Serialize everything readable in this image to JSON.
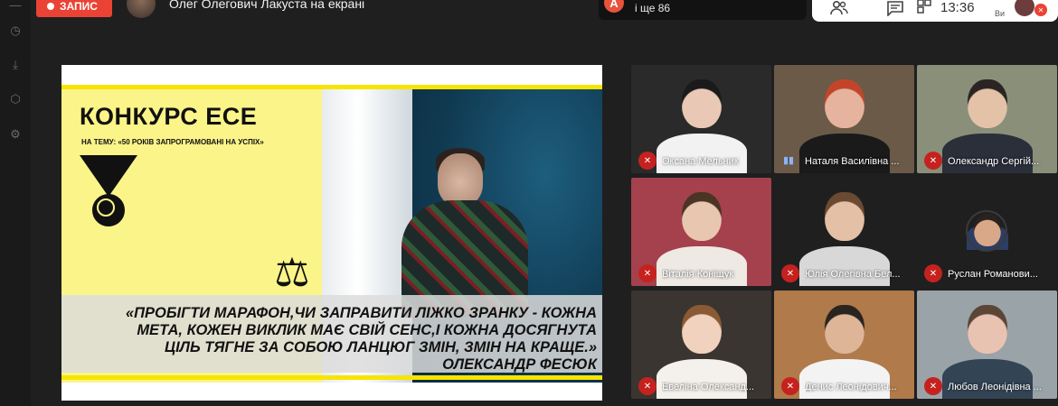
{
  "topbar": {
    "record_label": "ЗАПИС",
    "presenter_text": "Олег Олегович Лакуста на екрані",
    "notification": {
      "avatar_letter": "A",
      "text": "і ще 86"
    },
    "time": "13:36",
    "me_label": "Ви"
  },
  "slide": {
    "title": "КОНКУРС ЕСЕ",
    "subtitle": "НА ТЕМУ: «50 РОКІВ ЗАПРОГРАМОВАНІ НА УСПІХ»",
    "quote_lines": [
      "«ПРОБІГТИ МАРАФОН,ЧИ ЗАПРАВИТИ ЛІЖКО ЗРАНКУ - КОЖНА",
      "МЕТА, КОЖЕН ВИКЛИК МАЄ СВІЙ СЕНС,І КОЖНА ДОСЯГНУТА",
      "ЦІЛЬ ТЯГНЕ ЗА СОБОЮ ЛАНЦЮГ ЗМІН, ЗМІН НА КРАЩЕ.»",
      "ОЛЕКСАНДР ФЕСЮК"
    ]
  },
  "participants": [
    {
      "name": "Оксана Мельник",
      "muted": true,
      "bg": "#2a2a2a",
      "skin": "#e9c9b5",
      "cloth": "#f2f2f2",
      "hair": "#1a1a1a"
    },
    {
      "name": "Наталя Василівна ...",
      "muted": false,
      "bg": "#6b5a48",
      "skin": "#e6b49e",
      "cloth": "#1a1a1a",
      "hair": "#c2452a"
    },
    {
      "name": "Олександр Сергій...",
      "muted": true,
      "bg": "#8a8f7a",
      "skin": "#e4c2a8",
      "cloth": "#2b2f3a",
      "hair": "#2a2522"
    },
    {
      "name": "Віталія Коніщук",
      "muted": true,
      "bg": "#a4414d",
      "skin": "#e9c6b0",
      "cloth": "#efe9e4",
      "hair": "#4a3424"
    },
    {
      "name": "Юлія Олегівна Бел...",
      "muted": true,
      "bg": "#1f1f1f",
      "skin": "#e4c0a6",
      "cloth": "#d8d8d8",
      "hair": "#6a4a32"
    },
    {
      "name": "Руслан Романови...",
      "muted": true,
      "bg": "#1f1f1f",
      "skin": "#d9a889",
      "cloth": "#2c3e66",
      "hair": "#2a2220"
    },
    {
      "name": "Евеліна Олександ...",
      "muted": true,
      "bg": "#3a3530",
      "skin": "#f0d2bf",
      "cloth": "#f4f1ec",
      "hair": "#8a5a34"
    },
    {
      "name": "Денис Леонідович...",
      "muted": true,
      "bg": "#b07a4a",
      "skin": "#dfb598",
      "cloth": "#f3f3f3",
      "hair": "#2a2420"
    },
    {
      "name": "Любов Леонідівна ...",
      "muted": true,
      "bg": "#9aa3a8",
      "skin": "#e8c3b2",
      "cloth": "#334455",
      "hair": "#5a4536"
    }
  ],
  "icons": [
    "record-dot-icon",
    "people-icon",
    "chat-icon",
    "activities-icon",
    "mic-off-icon",
    "talking-icon",
    "scales-icon",
    "medal-icon"
  ]
}
